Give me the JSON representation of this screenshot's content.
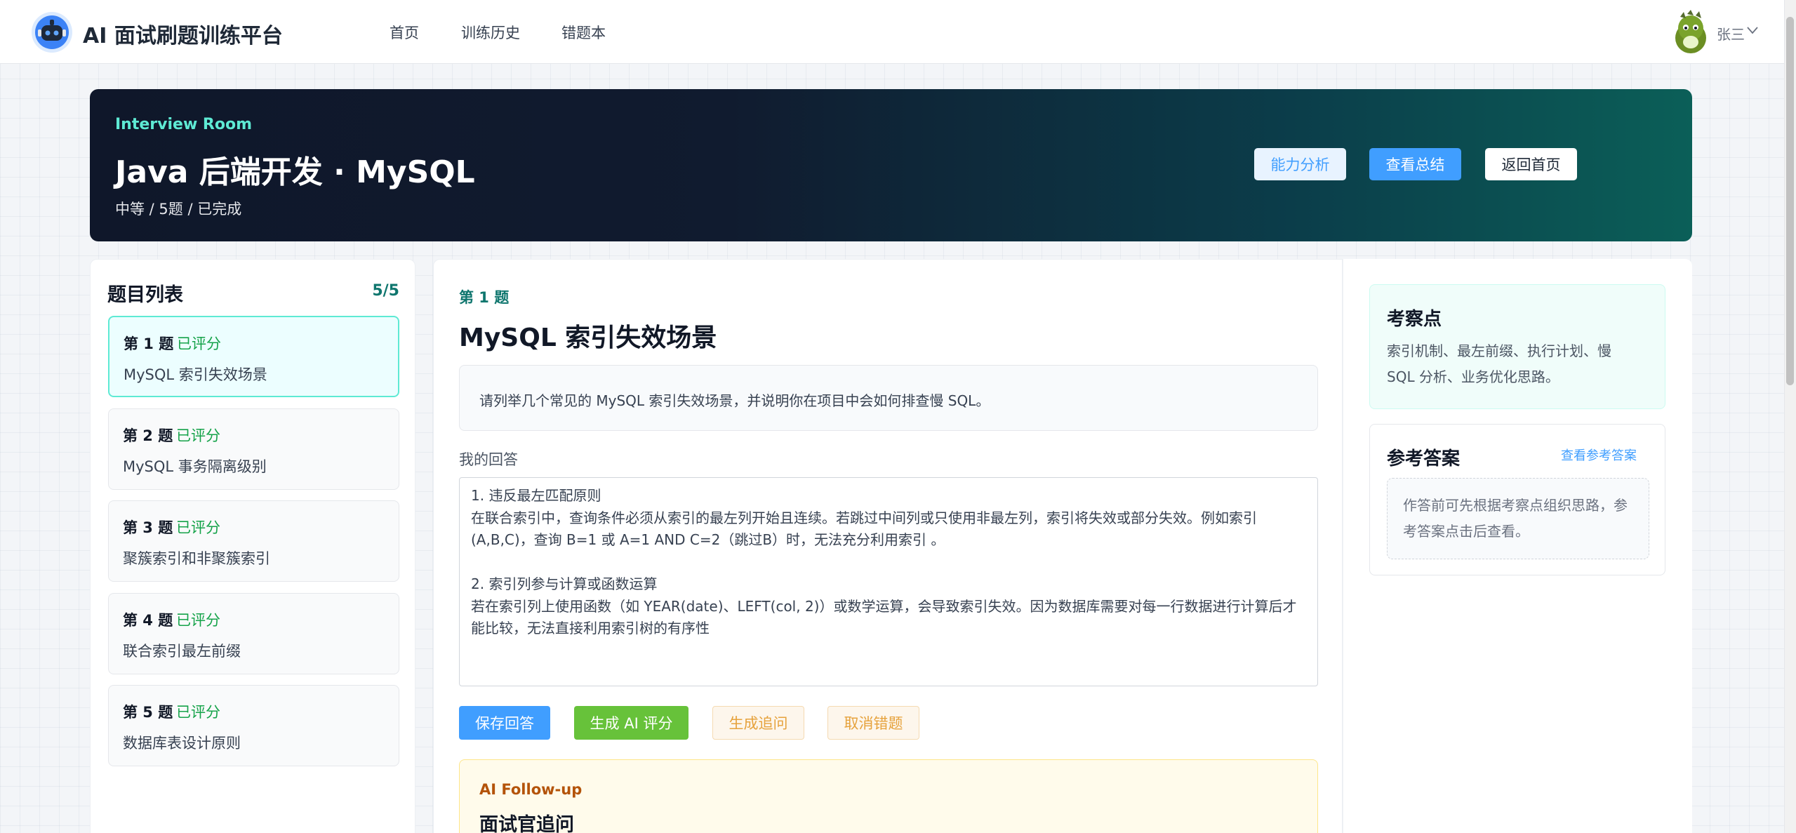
{
  "nav": {
    "brand": "AI 面试刷题训练平台",
    "links": [
      "首页",
      "训练历史",
      "错题本"
    ],
    "user": "张三"
  },
  "hero": {
    "eyebrow": "Interview Room",
    "title": "Java 后端开发 · MySQL",
    "meta": "中等 / 5题 / 已完成",
    "buttons": [
      "能力分析",
      "查看总结",
      "返回首页"
    ]
  },
  "question_list": {
    "title": "题目列表",
    "count": "5/5",
    "items": [
      {
        "num": "第 1 题",
        "status": "已评分",
        "name": "MySQL 索引失效场景",
        "active": true
      },
      {
        "num": "第 2 题",
        "status": "已评分",
        "name": "MySQL 事务隔离级别"
      },
      {
        "num": "第 3 题",
        "status": "已评分",
        "name": "聚簇索引和非聚簇索引"
      },
      {
        "num": "第 4 题",
        "status": "已评分",
        "name": "联合索引最左前缀"
      },
      {
        "num": "第 5 题",
        "status": "已评分",
        "name": "数据库表设计原则"
      }
    ]
  },
  "current": {
    "label": "第 1 题",
    "title": "MySQL 索引失效场景",
    "prompt": "请列举几个常见的 MySQL 索引失效场景，并说明你在项目中会如何排查慢 SQL。",
    "answer_label": "我的回答",
    "answer": "1. 违反最左匹配原则\n在联合索引中，查询条件必须从索引的最左列开始且连续。若跳过中间列或只使用非最左列，索引将失效或部分失效。例如索引(A,B,C)，查询 B=1 或 A=1 AND C=2（跳过B）时，无法充分利用索引 。\n\n2. 索引列参与计算或函数运算\n若在索引列上使用函数（如 YEAR(date)、LEFT(col, 2)）或数学运算，会导致索引失效。因为数据库需要对每一行数据进行计算后才能比较，无法直接利用索引树的有序性",
    "actions": {
      "save": "保存回答",
      "ai_score": "生成 AI 评分",
      "followup": "生成追问",
      "unmark": "取消错题"
    },
    "followup": {
      "eyebrow": "AI Follow-up",
      "title": "面试官追问"
    }
  },
  "sidebar": {
    "points_title": "考察点",
    "points_body": "索引机制、最左前缀、执行计划、慢 SQL 分析、业务优化思路。",
    "ref_title": "参考答案",
    "ref_link": "查看参考答案",
    "ref_placeholder": "作答前可先根据考察点组织思路，参考答案点击后查看。"
  },
  "colors": {
    "primary": "#409eff",
    "success": "#67c23a",
    "warning": "#e6a23c",
    "teal": "#0f766e",
    "hero_dark": "#0f172a"
  },
  "icons": [
    "robot-logo-icon",
    "dinosaur-avatar-icon",
    "chevron-down-icon"
  ]
}
